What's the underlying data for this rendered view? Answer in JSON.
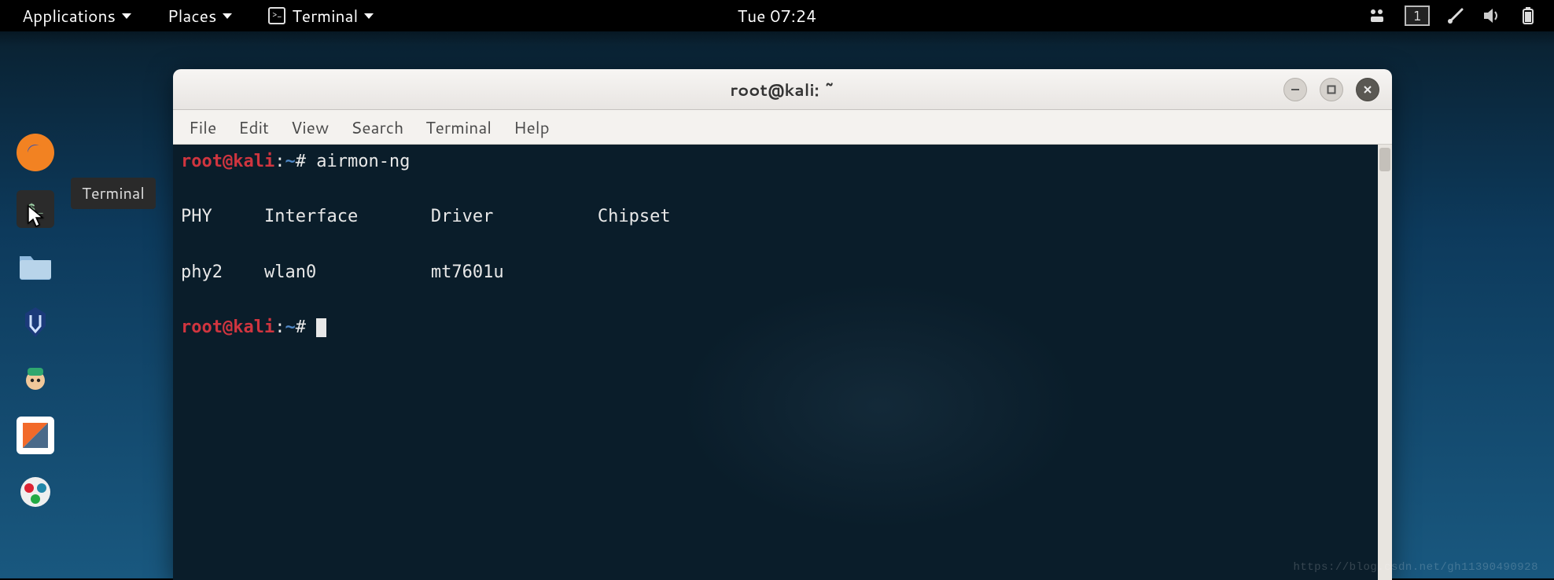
{
  "topbar": {
    "applications": "Applications",
    "places": "Places",
    "terminal": "Terminal",
    "clock": "Tue 07:24",
    "workspace": "1"
  },
  "dock": {
    "tooltip": "Terminal"
  },
  "terminal_window": {
    "title": "root@kali: ~",
    "menus": {
      "file": "File",
      "edit": "Edit",
      "view": "View",
      "search": "Search",
      "terminal": "Terminal",
      "help": "Help"
    },
    "prompt_user": "root@kali",
    "prompt_sep": ":",
    "prompt_path": "~",
    "prompt_hash": "#",
    "command1": "airmon-ng",
    "headers": {
      "phy": "PHY",
      "iface": "Interface",
      "driver": "Driver",
      "chipset": "Chipset"
    },
    "row": {
      "phy": "phy2",
      "iface": "wlan0",
      "driver": "mt7601u",
      "chipset": ""
    }
  },
  "watermark": "https://blog.csdn.net/gh11390490928"
}
